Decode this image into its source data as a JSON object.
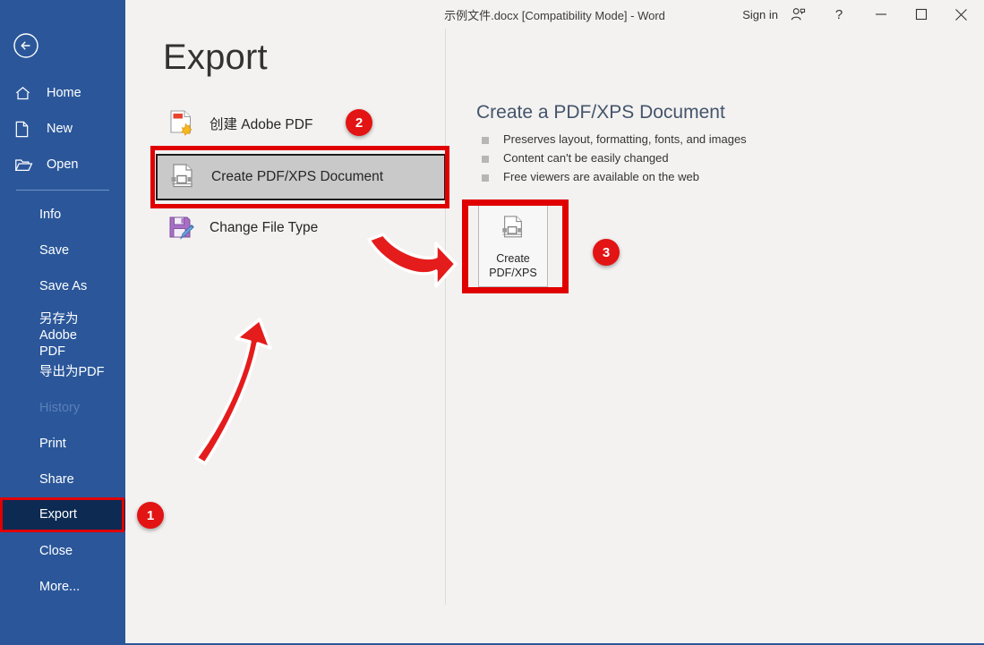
{
  "window": {
    "doc_title": "示例文件.docx [Compatibility Mode]  -  Word",
    "sign_in": "Sign in",
    "account_icon": "account-icon",
    "help_icon": "help-icon",
    "minimize_icon": "minimize-icon",
    "maximize_icon": "maximize-icon",
    "close_icon": "close-icon"
  },
  "sidebar": {
    "back_icon": "back-arrow-icon",
    "accent_color": "#2b579a",
    "active_color": "#0d2a53",
    "top_items": [
      {
        "label": "Home",
        "icon": "home-icon"
      },
      {
        "label": "New",
        "icon": "new-document-icon"
      },
      {
        "label": "Open",
        "icon": "open-folder-icon"
      }
    ],
    "items": [
      {
        "label": "Info",
        "state": "normal"
      },
      {
        "label": "Save",
        "state": "normal"
      },
      {
        "label": "Save As",
        "state": "normal"
      },
      {
        "label": "另存为 Adobe PDF",
        "state": "normal"
      },
      {
        "label": "导出为PDF",
        "state": "normal"
      },
      {
        "label": "History",
        "state": "disabled"
      },
      {
        "label": "Print",
        "state": "normal"
      },
      {
        "label": "Share",
        "state": "normal"
      },
      {
        "label": "Export",
        "state": "active"
      },
      {
        "label": "Close",
        "state": "normal"
      },
      {
        "label": "More...",
        "state": "normal"
      }
    ]
  },
  "page": {
    "title": "Export"
  },
  "export_options": [
    {
      "label": "创建 Adobe PDF",
      "icon": "adobe-pdf-icon",
      "selected": false
    },
    {
      "label": "Create PDF/XPS Document",
      "icon": "pdf-xps-icon",
      "selected": true
    },
    {
      "label": "Change File Type",
      "icon": "save-pencil-icon",
      "selected": false
    }
  ],
  "detail": {
    "title": "Create a PDF/XPS Document",
    "bullets": [
      "Preserves layout, formatting, fonts, and images",
      "Content can't be easily changed",
      "Free viewers are available on the web"
    ],
    "action_button": {
      "icon": "pdf-xps-icon",
      "line1": "Create",
      "line2": "PDF/XPS"
    }
  },
  "annotations": {
    "highlight_color": "#e00000",
    "badge_color": "#e31414",
    "badges": [
      {
        "number": "1",
        "target": "sidebar-item-export"
      },
      {
        "number": "2",
        "target": "export-option-create-pdf-xps"
      },
      {
        "number": "3",
        "target": "create-pdf-xps-button"
      }
    ],
    "arrows": [
      {
        "name": "arrow-to-create-pdf-xps-button",
        "direction": "right"
      },
      {
        "name": "arrow-to-export-option",
        "direction": "up"
      }
    ]
  }
}
